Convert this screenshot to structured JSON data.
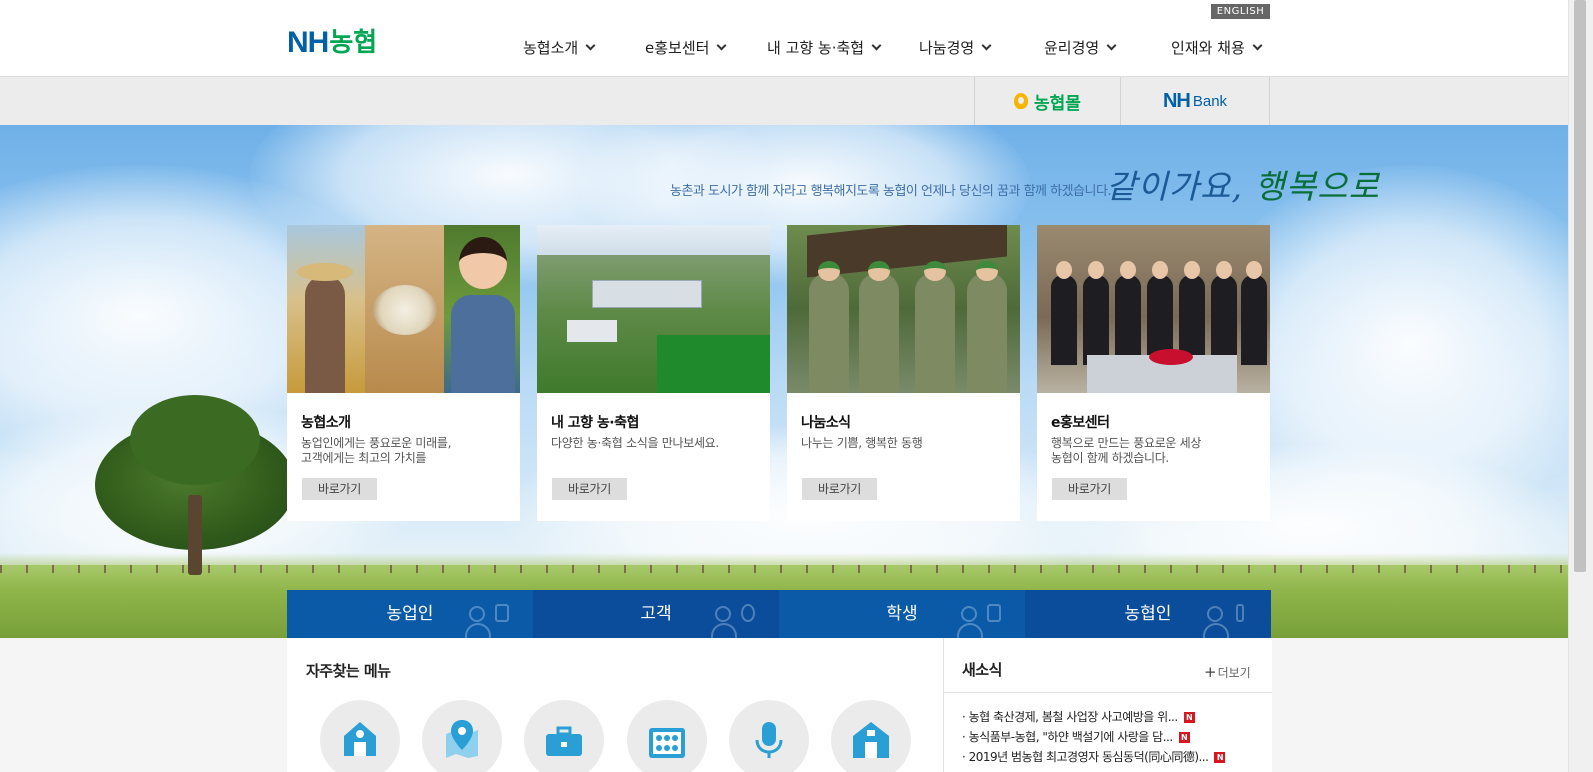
{
  "header": {
    "logo_text_latin": "NH",
    "logo_text_korean": "농협",
    "english_button": "ENGLISH",
    "nav": [
      "농협소개",
      "e홍보센터",
      "내 고향 농·축협",
      "나눔경영",
      "윤리경영",
      "인재와 채용"
    ]
  },
  "family_sites": {
    "mall": "농협몰",
    "bank_nh": "NH",
    "bank_text": "Bank"
  },
  "hero": {
    "slogan_small": "농촌과 도시가 함께 자라고 행복해지도록 농협이 언제나 당신의 꿈과 함께 하겠습니다.",
    "slogan_big_part1": "같이가요, ",
    "slogan_big_part2": "행복으로"
  },
  "cards": [
    {
      "title": "농협소개",
      "desc_line1": "농업인에게는 풍요로운 미래를,",
      "desc_line2": "고객에게는 최고의 가치를",
      "button": "바로가기"
    },
    {
      "title": "내 고향 농·축협",
      "desc_line1": "다양한 농·축협 소식을 만나보세요.",
      "desc_line2": "",
      "button": "바로가기"
    },
    {
      "title": "나눔소식",
      "desc_line1": "나누는 기쁨, 행복한 동행",
      "desc_line2": "",
      "button": "바로가기"
    },
    {
      "title": "e홍보센터",
      "desc_line1": "행복으로 만드는 풍요로운 세상",
      "desc_line2": "농협이 함께 하겠습니다.",
      "button": "바로가기"
    }
  ],
  "audience_tabs": [
    {
      "label": "농업인",
      "color": "#0a5aa8"
    },
    {
      "label": "고객",
      "color": "#0b4d9a"
    },
    {
      "label": "학생",
      "color": "#0a5aa8"
    },
    {
      "label": "농협인",
      "color": "#0b4d9a"
    }
  ],
  "quick_menu": {
    "title": "자주찾는 메뉴",
    "icons": [
      "house-icon",
      "map-pin-icon",
      "briefcase-icon",
      "abacus-icon",
      "microphone-icon",
      "barn-icon"
    ]
  },
  "news": {
    "title": "새소식",
    "more": "더보기",
    "badge": "N",
    "items": [
      "· 농협 축산경제, 봄철 사업장 사고예방을 위...",
      "· 농식품부-농협, \"하얀 백설기에 사랑을 담...",
      "· 2019년 범농협 최고경영자 동심동덕(同心同德)..."
    ]
  },
  "colors": {
    "brand_blue": "#0060a8",
    "brand_green": "#00a651",
    "mall_yellow": "#f7b500",
    "tab_blue_a": "#0a5aa8",
    "tab_blue_b": "#0b4d9a",
    "quick_icon_blue": "#2a9fd6",
    "news_badge_red": "#d8161f"
  }
}
